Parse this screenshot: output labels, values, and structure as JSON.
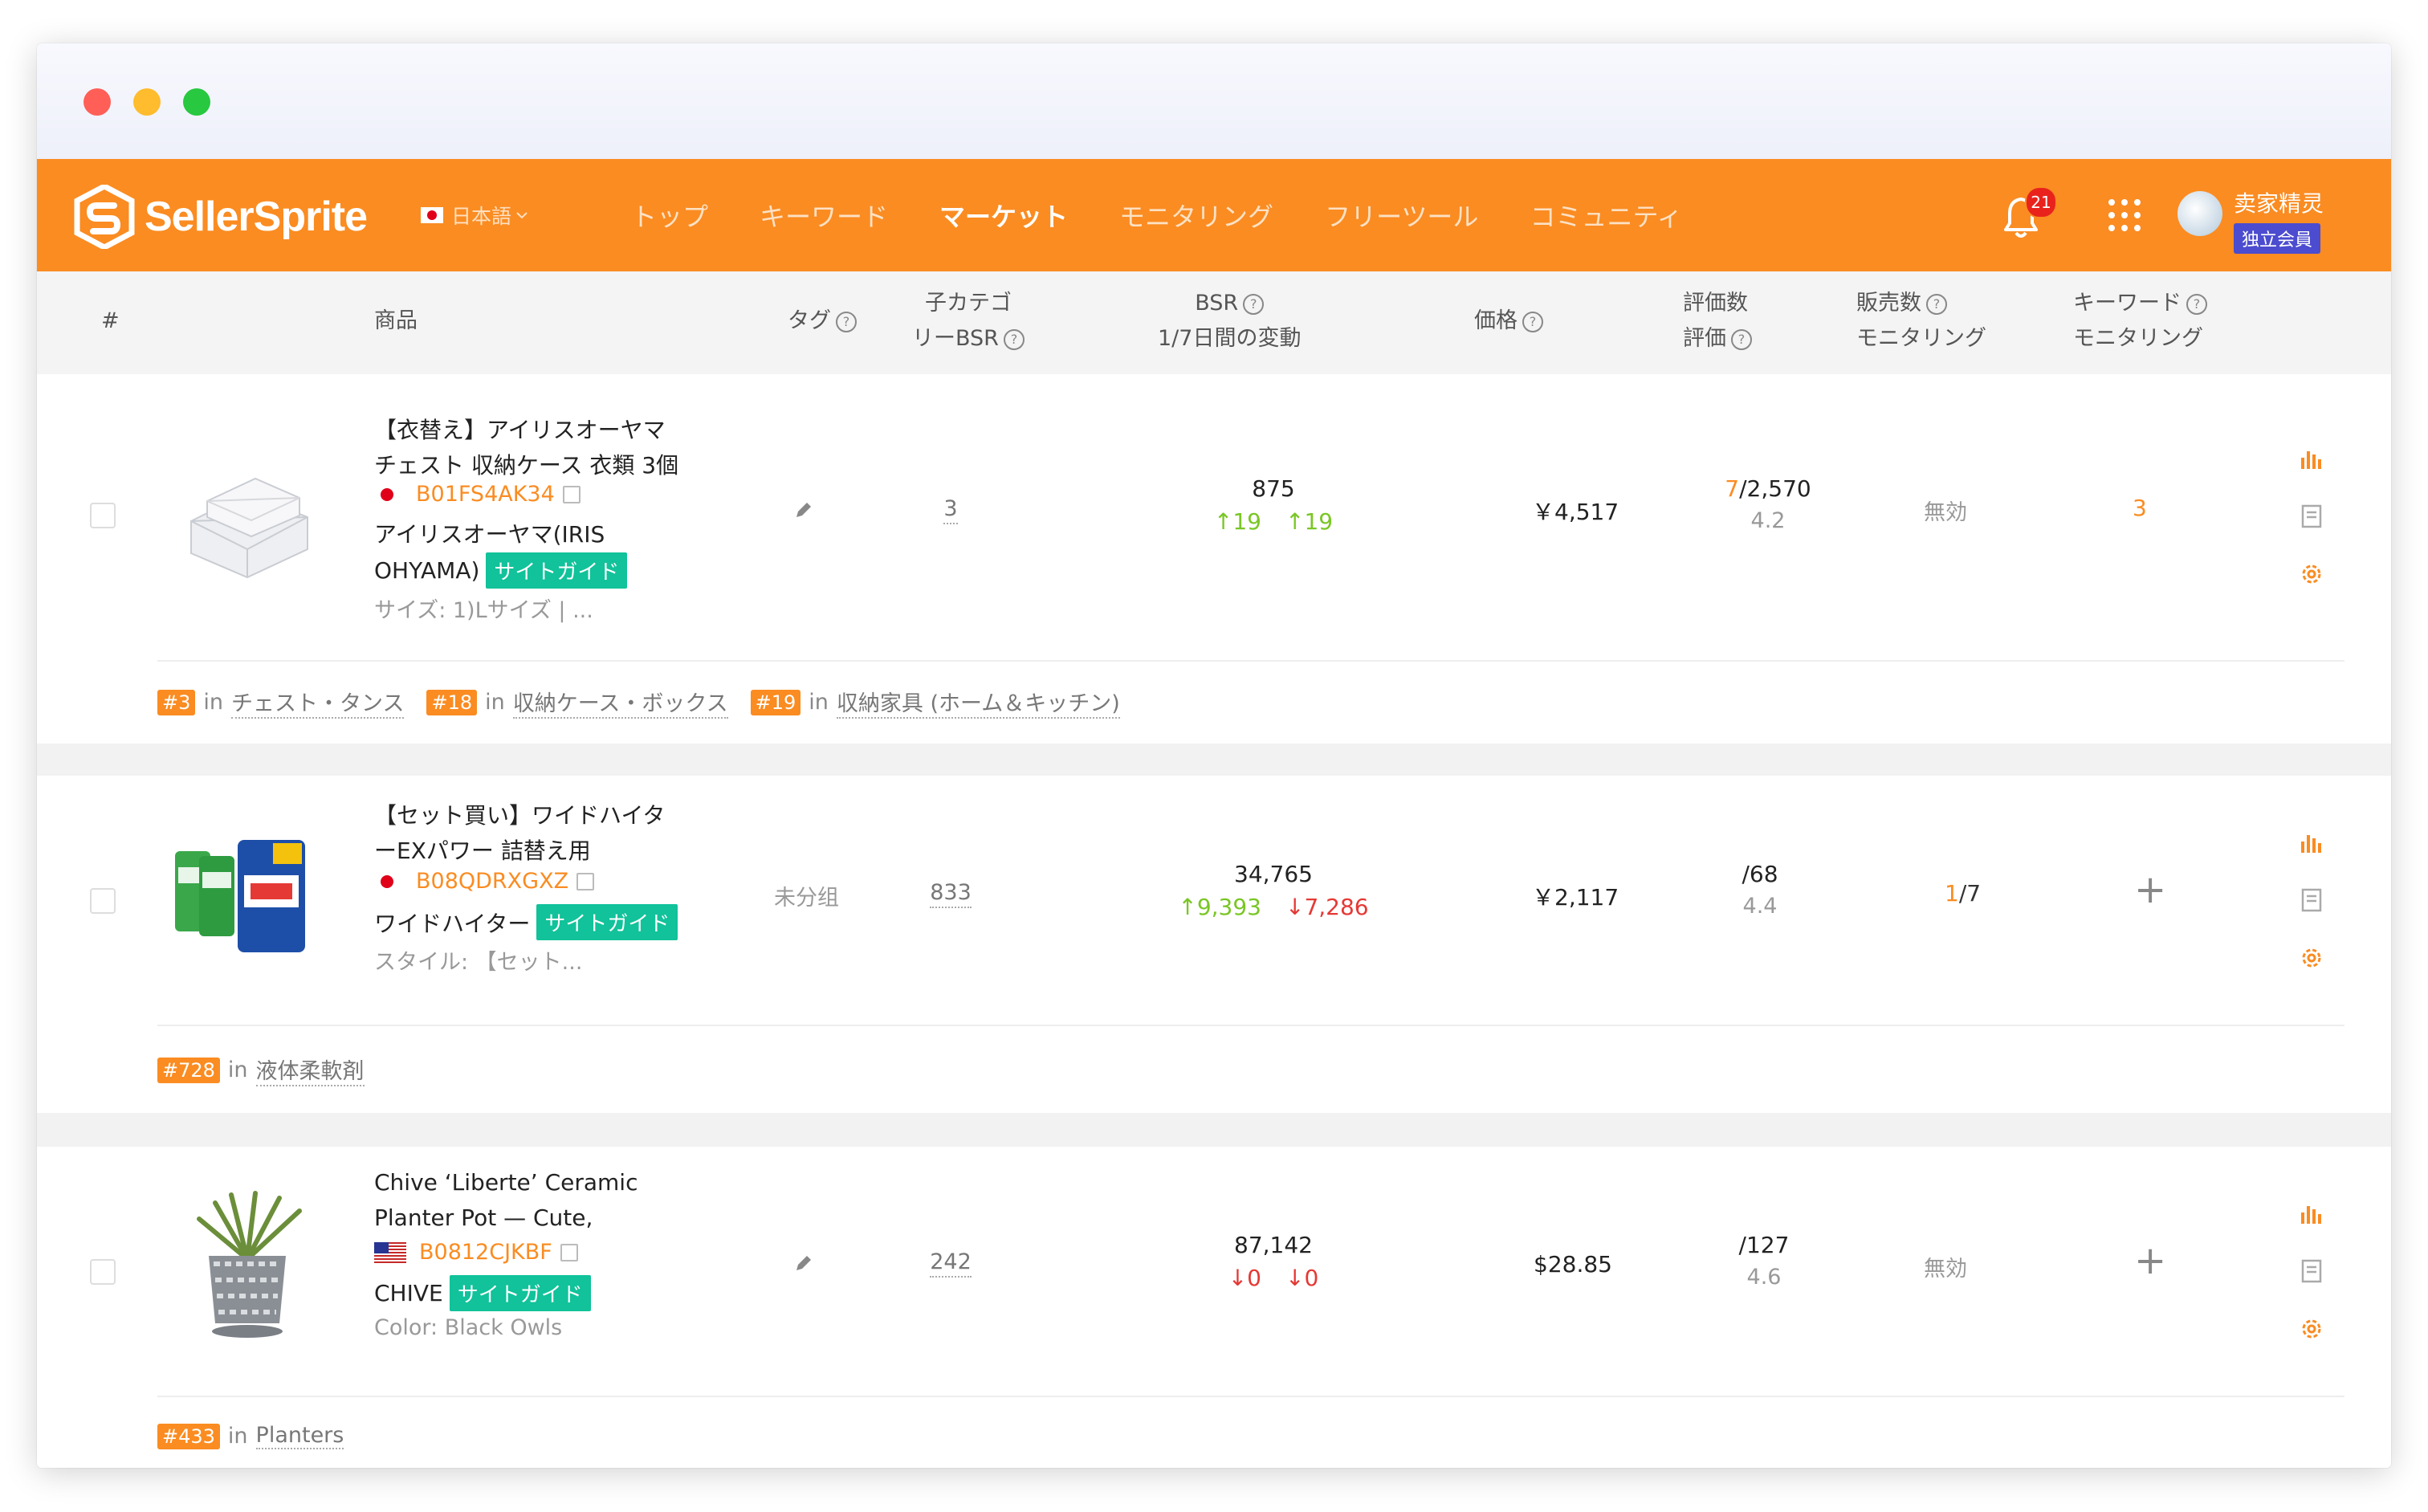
{
  "brand": {
    "name": "SellerSprite",
    "language": "日本語"
  },
  "nav": {
    "items": [
      "トップ",
      "キーワード",
      "マーケット",
      "モニタリング",
      "フリーツール",
      "コミュニティ"
    ],
    "active_index": 2
  },
  "notifications": {
    "count": "21"
  },
  "user": {
    "name": "卖家精灵",
    "badge": "独立会員"
  },
  "table": {
    "headers": {
      "index": "#",
      "product": "商品",
      "tag": "タグ",
      "sub_bsr_line1": "子カテゴ",
      "sub_bsr_line2": "リーBSR",
      "bsr_line1": "BSR",
      "bsr_line2": "1/7日間の変動",
      "price": "価格",
      "reviews_line1": "評価数",
      "reviews_line2": "評価",
      "sales_line1": "販売数",
      "sales_line2": "モニタリング",
      "kw_line1": "キーワード",
      "kw_line2": "モニタリング"
    },
    "rows": [
      {
        "title_line1": "【衣替え】アイリスオーヤマ",
        "title_line2": "チェスト 収納ケース 衣類 3個",
        "marketplace": "JP",
        "asin": "B01FS4AK34",
        "brand_line1": "アイリスオーヤマ(IRIS",
        "brand_line2": "OHYAMA)",
        "guide": "サイトガイド",
        "variant": "サイズ: 1)Lサイズ | ...",
        "tag": "",
        "sub_bsr": "3",
        "bsr": "875",
        "bsr_change_1": "↑19",
        "bsr_change_7": "↑19",
        "price": "￥4,517",
        "reviews_highlight": "7",
        "reviews_total": "/2,570",
        "rating": "4.2",
        "sales_monitor": "無効",
        "kw_monitor": "3",
        "categories": [
          {
            "rank": "#3",
            "in": "in",
            "name": "チェスト・タンス"
          },
          {
            "rank": "#18",
            "in": "in",
            "name": "収納ケース・ボックス"
          },
          {
            "rank": "#19",
            "in": "in",
            "name": "収納家具 (ホーム＆キッチン)"
          }
        ]
      },
      {
        "title_line1": "【セット買い】ワイドハイタ",
        "title_line2": "ーEXパワー 詰替え用",
        "marketplace": "JP",
        "asin": "B08QDRXGXZ",
        "brand_line1": "ワイドハイター",
        "guide": "サイトガイド",
        "variant": "スタイル: 【セット...",
        "tag": "未分组",
        "sub_bsr": "833",
        "bsr": "34,765",
        "bsr_change_1": "↑9,393",
        "bsr_change_7": "↓7,286",
        "price": "￥2,117",
        "reviews_total": "/68",
        "rating": "4.4",
        "sales_highlight": "1",
        "sales_total": "/7",
        "kw_monitor": "+",
        "categories": [
          {
            "rank": "#728",
            "in": "in",
            "name": "液体柔軟剤"
          }
        ]
      },
      {
        "title_line1": "Chive ‘Liberte’ Ceramic",
        "title_line2": "Planter Pot — Cute,",
        "marketplace": "US",
        "asin": "B0812CJKBF",
        "brand_line1": "CHIVE",
        "guide": "サイトガイド",
        "variant": "Color: Black Owls",
        "tag": "",
        "sub_bsr": "242",
        "bsr": "87,142",
        "bsr_change_1": "↓0",
        "bsr_change_7": "↓0",
        "price": "$28.85",
        "reviews_total": "/127",
        "rating": "4.6",
        "sales_monitor": "無効",
        "kw_monitor": "+",
        "categories": [
          {
            "rank": "#433",
            "in": "in",
            "name": "Planters"
          }
        ]
      }
    ]
  },
  "colors": {
    "brand_orange": "#fa8c22",
    "guide_green": "#11c29a",
    "up_green": "#7ac625",
    "down_red": "#e53935",
    "badge_purple": "#4b4ccf"
  },
  "icons": [
    "logo-icon",
    "flag-jp-icon",
    "chevron-down-icon",
    "bell-icon",
    "apps-grid-icon",
    "help-circle-icon",
    "external-link-icon",
    "pencil-icon",
    "bar-chart-icon",
    "notes-icon",
    "settings-gear-icon",
    "plus-icon",
    "flag-us-icon"
  ]
}
